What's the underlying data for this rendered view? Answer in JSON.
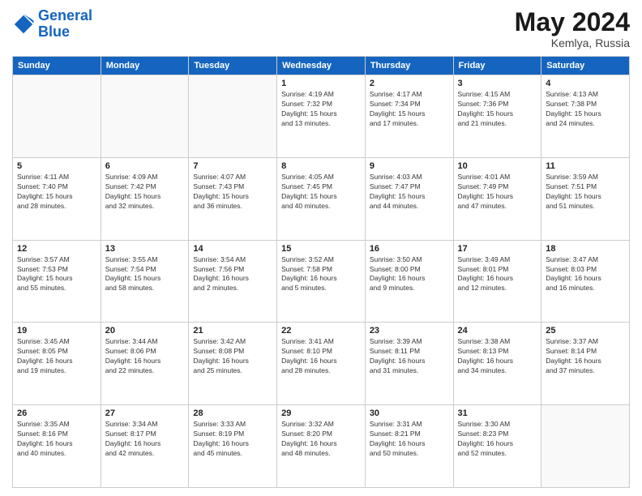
{
  "header": {
    "logo_line1": "General",
    "logo_line2": "Blue",
    "calendar_title": "May 2024",
    "calendar_subtitle": "Kemlya, Russia"
  },
  "columns": [
    "Sunday",
    "Monday",
    "Tuesday",
    "Wednesday",
    "Thursday",
    "Friday",
    "Saturday"
  ],
  "weeks": [
    [
      {
        "day": "",
        "info": ""
      },
      {
        "day": "",
        "info": ""
      },
      {
        "day": "",
        "info": ""
      },
      {
        "day": "1",
        "info": "Sunrise: 4:19 AM\nSunset: 7:32 PM\nDaylight: 15 hours\nand 13 minutes."
      },
      {
        "day": "2",
        "info": "Sunrise: 4:17 AM\nSunset: 7:34 PM\nDaylight: 15 hours\nand 17 minutes."
      },
      {
        "day": "3",
        "info": "Sunrise: 4:15 AM\nSunset: 7:36 PM\nDaylight: 15 hours\nand 21 minutes."
      },
      {
        "day": "4",
        "info": "Sunrise: 4:13 AM\nSunset: 7:38 PM\nDaylight: 15 hours\nand 24 minutes."
      }
    ],
    [
      {
        "day": "5",
        "info": "Sunrise: 4:11 AM\nSunset: 7:40 PM\nDaylight: 15 hours\nand 28 minutes."
      },
      {
        "day": "6",
        "info": "Sunrise: 4:09 AM\nSunset: 7:42 PM\nDaylight: 15 hours\nand 32 minutes."
      },
      {
        "day": "7",
        "info": "Sunrise: 4:07 AM\nSunset: 7:43 PM\nDaylight: 15 hours\nand 36 minutes."
      },
      {
        "day": "8",
        "info": "Sunrise: 4:05 AM\nSunset: 7:45 PM\nDaylight: 15 hours\nand 40 minutes."
      },
      {
        "day": "9",
        "info": "Sunrise: 4:03 AM\nSunset: 7:47 PM\nDaylight: 15 hours\nand 44 minutes."
      },
      {
        "day": "10",
        "info": "Sunrise: 4:01 AM\nSunset: 7:49 PM\nDaylight: 15 hours\nand 47 minutes."
      },
      {
        "day": "11",
        "info": "Sunrise: 3:59 AM\nSunset: 7:51 PM\nDaylight: 15 hours\nand 51 minutes."
      }
    ],
    [
      {
        "day": "12",
        "info": "Sunrise: 3:57 AM\nSunset: 7:53 PM\nDaylight: 15 hours\nand 55 minutes."
      },
      {
        "day": "13",
        "info": "Sunrise: 3:55 AM\nSunset: 7:54 PM\nDaylight: 15 hours\nand 58 minutes."
      },
      {
        "day": "14",
        "info": "Sunrise: 3:54 AM\nSunset: 7:56 PM\nDaylight: 16 hours\nand 2 minutes."
      },
      {
        "day": "15",
        "info": "Sunrise: 3:52 AM\nSunset: 7:58 PM\nDaylight: 16 hours\nand 5 minutes."
      },
      {
        "day": "16",
        "info": "Sunrise: 3:50 AM\nSunset: 8:00 PM\nDaylight: 16 hours\nand 9 minutes."
      },
      {
        "day": "17",
        "info": "Sunrise: 3:49 AM\nSunset: 8:01 PM\nDaylight: 16 hours\nand 12 minutes."
      },
      {
        "day": "18",
        "info": "Sunrise: 3:47 AM\nSunset: 8:03 PM\nDaylight: 16 hours\nand 16 minutes."
      }
    ],
    [
      {
        "day": "19",
        "info": "Sunrise: 3:45 AM\nSunset: 8:05 PM\nDaylight: 16 hours\nand 19 minutes."
      },
      {
        "day": "20",
        "info": "Sunrise: 3:44 AM\nSunset: 8:06 PM\nDaylight: 16 hours\nand 22 minutes."
      },
      {
        "day": "21",
        "info": "Sunrise: 3:42 AM\nSunset: 8:08 PM\nDaylight: 16 hours\nand 25 minutes."
      },
      {
        "day": "22",
        "info": "Sunrise: 3:41 AM\nSunset: 8:10 PM\nDaylight: 16 hours\nand 28 minutes."
      },
      {
        "day": "23",
        "info": "Sunrise: 3:39 AM\nSunset: 8:11 PM\nDaylight: 16 hours\nand 31 minutes."
      },
      {
        "day": "24",
        "info": "Sunrise: 3:38 AM\nSunset: 8:13 PM\nDaylight: 16 hours\nand 34 minutes."
      },
      {
        "day": "25",
        "info": "Sunrise: 3:37 AM\nSunset: 8:14 PM\nDaylight: 16 hours\nand 37 minutes."
      }
    ],
    [
      {
        "day": "26",
        "info": "Sunrise: 3:35 AM\nSunset: 8:16 PM\nDaylight: 16 hours\nand 40 minutes."
      },
      {
        "day": "27",
        "info": "Sunrise: 3:34 AM\nSunset: 8:17 PM\nDaylight: 16 hours\nand 42 minutes."
      },
      {
        "day": "28",
        "info": "Sunrise: 3:33 AM\nSunset: 8:19 PM\nDaylight: 16 hours\nand 45 minutes."
      },
      {
        "day": "29",
        "info": "Sunrise: 3:32 AM\nSunset: 8:20 PM\nDaylight: 16 hours\nand 48 minutes."
      },
      {
        "day": "30",
        "info": "Sunrise: 3:31 AM\nSunset: 8:21 PM\nDaylight: 16 hours\nand 50 minutes."
      },
      {
        "day": "31",
        "info": "Sunrise: 3:30 AM\nSunset: 8:23 PM\nDaylight: 16 hours\nand 52 minutes."
      },
      {
        "day": "",
        "info": ""
      }
    ]
  ]
}
